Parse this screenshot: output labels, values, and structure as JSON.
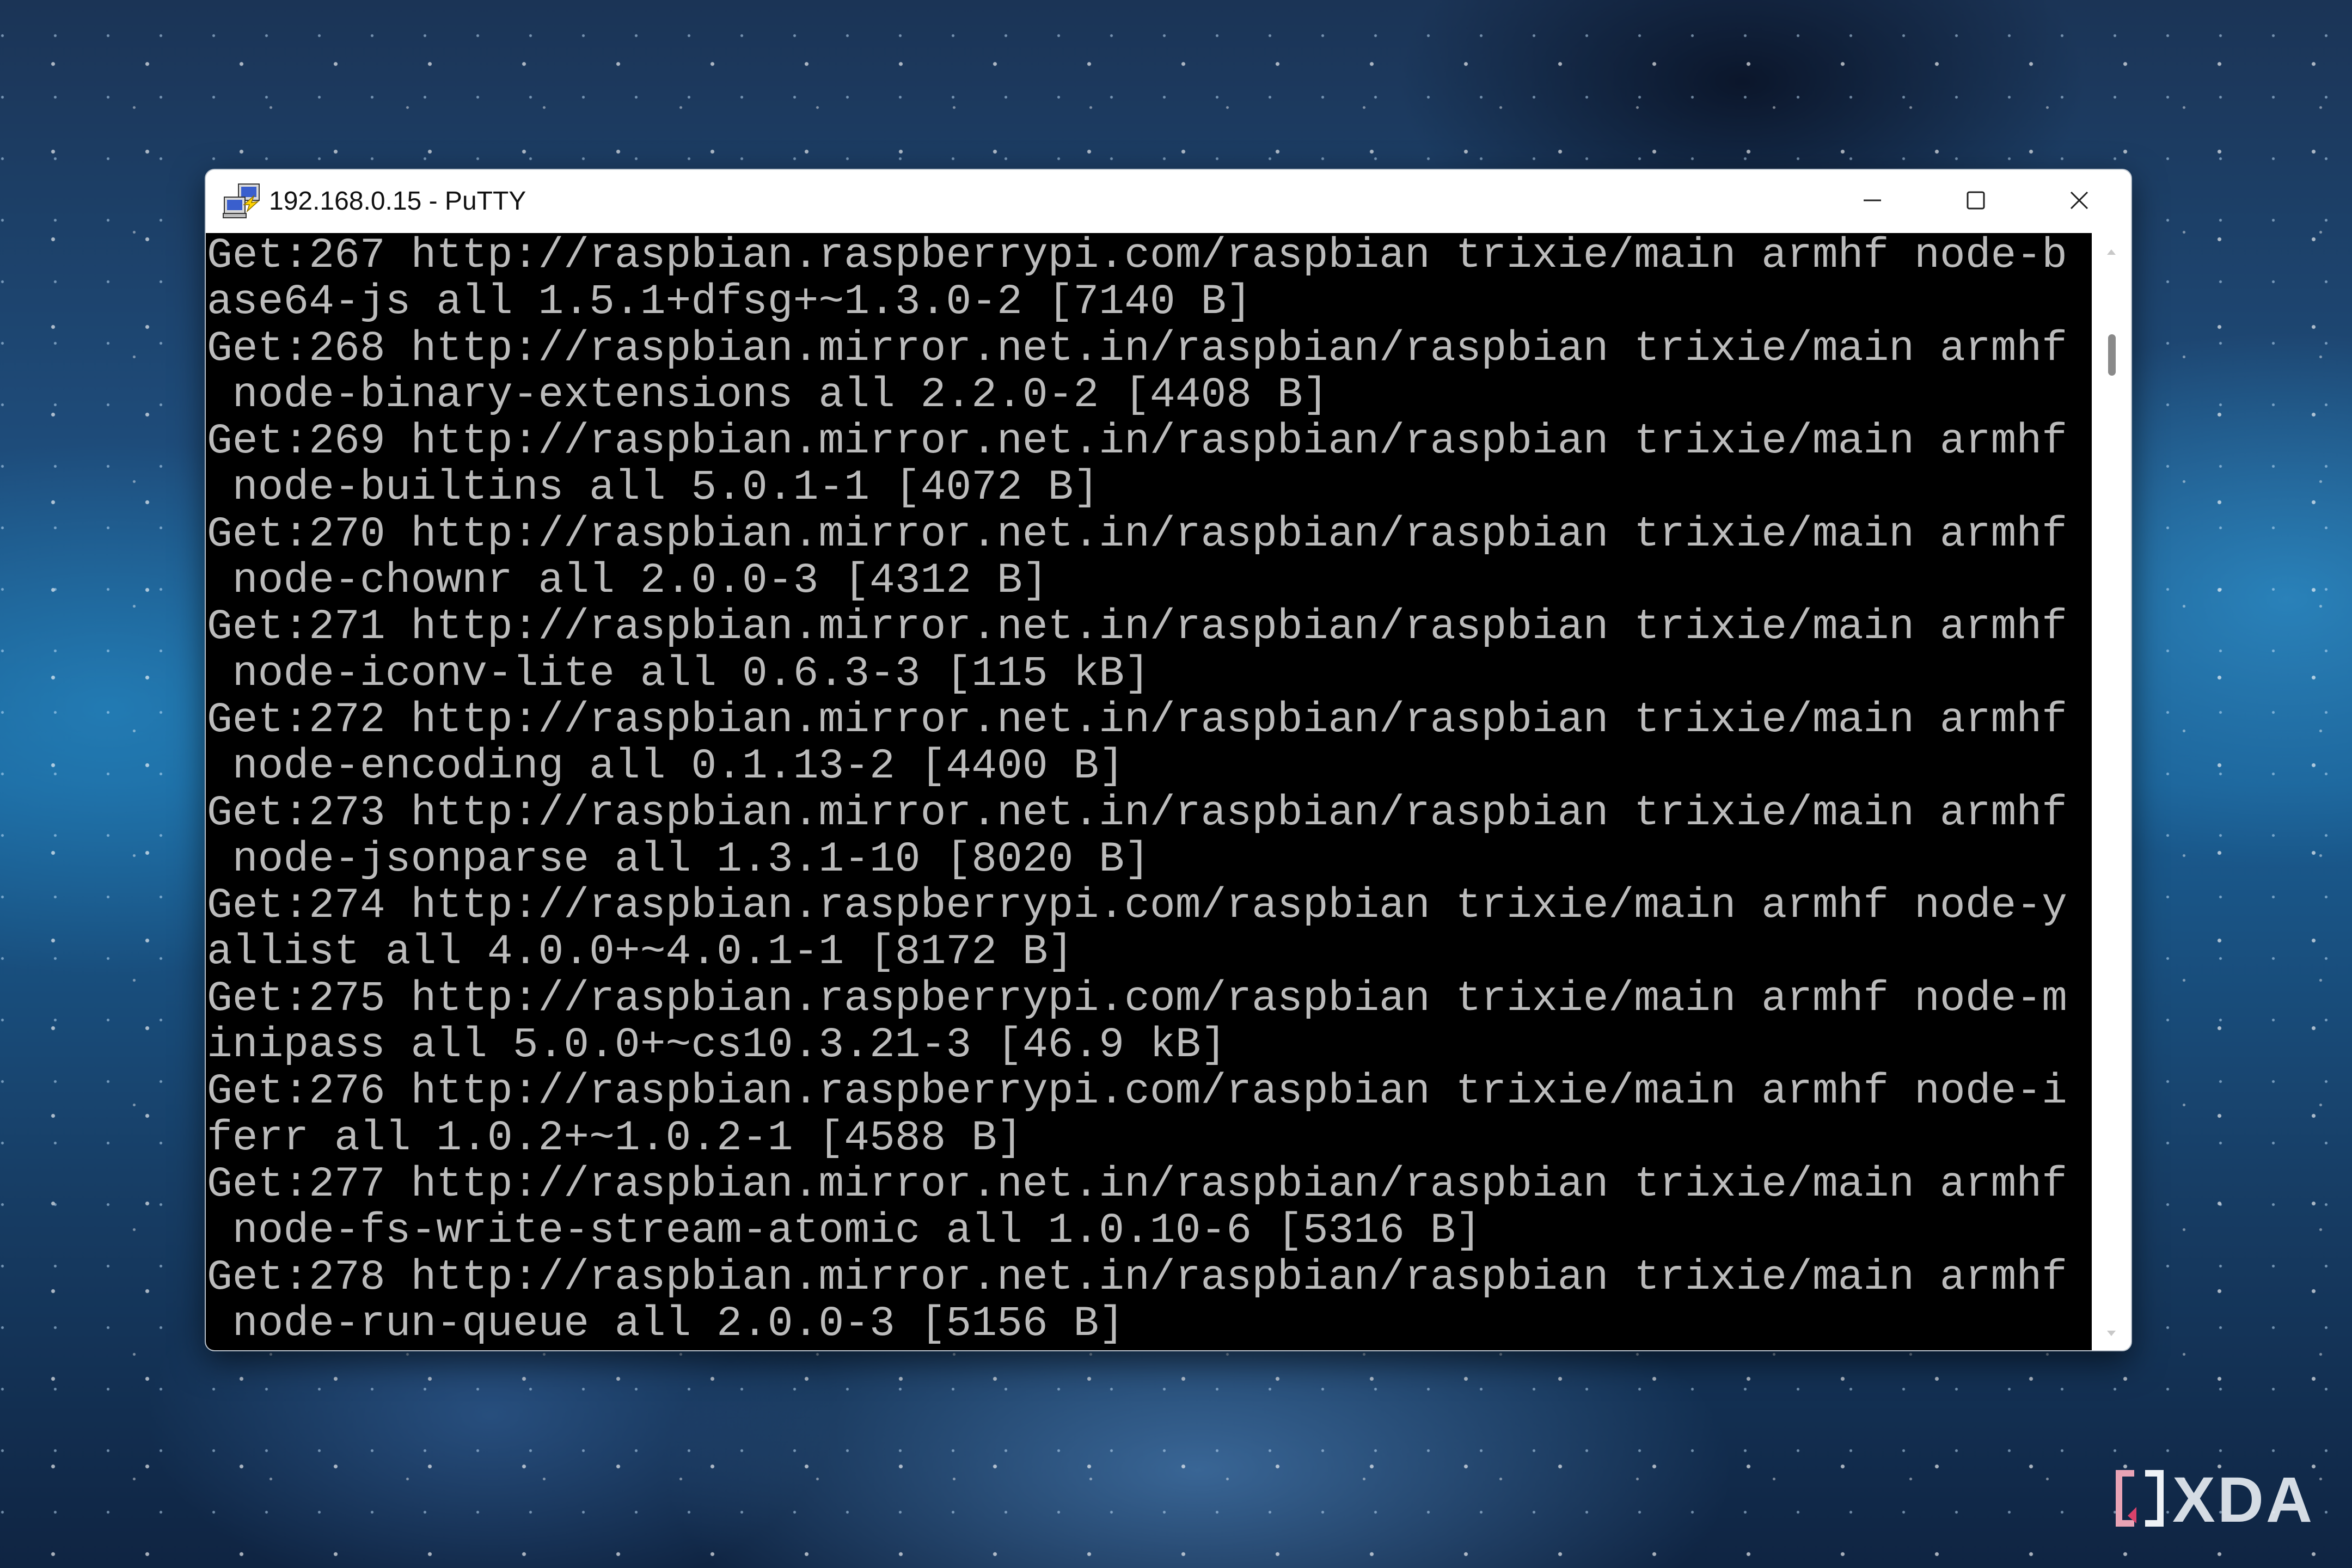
{
  "window": {
    "title": "192.168.0.15 - PuTTY",
    "app_icon": "putty-computers-icon",
    "controls": {
      "minimize_icon": "minimize-icon",
      "maximize_icon": "maximize-icon",
      "close_icon": "close-icon"
    }
  },
  "terminal": {
    "background": "#000000",
    "foreground": "#bbbbbb",
    "lines": [
      "Get:267 http://raspbian.raspberrypi.com/raspbian trixie/main armhf node-b",
      "ase64-js all 1.5.1+dfsg+~1.3.0-2 [7140 B]",
      "Get:268 http://raspbian.mirror.net.in/raspbian/raspbian trixie/main armhf",
      " node-binary-extensions all 2.2.0-2 [4408 B]",
      "Get:269 http://raspbian.mirror.net.in/raspbian/raspbian trixie/main armhf",
      " node-builtins all 5.0.1-1 [4072 B]",
      "Get:270 http://raspbian.mirror.net.in/raspbian/raspbian trixie/main armhf",
      " node-chownr all 2.0.0-3 [4312 B]",
      "Get:271 http://raspbian.mirror.net.in/raspbian/raspbian trixie/main armhf",
      " node-iconv-lite all 0.6.3-3 [115 kB]",
      "Get:272 http://raspbian.mirror.net.in/raspbian/raspbian trixie/main armhf",
      " node-encoding all 0.1.13-2 [4400 B]",
      "Get:273 http://raspbian.mirror.net.in/raspbian/raspbian trixie/main armhf",
      " node-jsonparse all 1.3.1-10 [8020 B]",
      "Get:274 http://raspbian.raspberrypi.com/raspbian trixie/main armhf node-y",
      "allist all 4.0.0+~4.0.1-1 [8172 B]",
      "Get:275 http://raspbian.raspberrypi.com/raspbian trixie/main armhf node-m",
      "inipass all 5.0.0+~cs10.3.21-3 [46.9 kB]",
      "Get:276 http://raspbian.raspberrypi.com/raspbian trixie/main armhf node-i",
      "ferr all 1.0.2+~1.0.2-1 [4588 B]",
      "Get:277 http://raspbian.mirror.net.in/raspbian/raspbian trixie/main armhf",
      " node-fs-write-stream-atomic all 1.0.10-6 [5316 B]",
      "Get:278 http://raspbian.mirror.net.in/raspbian/raspbian trixie/main armhf",
      " node-run-queue all 2.0.0-3 [5156 B]"
    ]
  },
  "scrollbar": {
    "up_icon": "scroll-up-arrow-icon",
    "down_icon": "scroll-down-arrow-icon"
  },
  "watermark": {
    "text": "XDA",
    "icon": "xda-bracket-logo-icon"
  }
}
